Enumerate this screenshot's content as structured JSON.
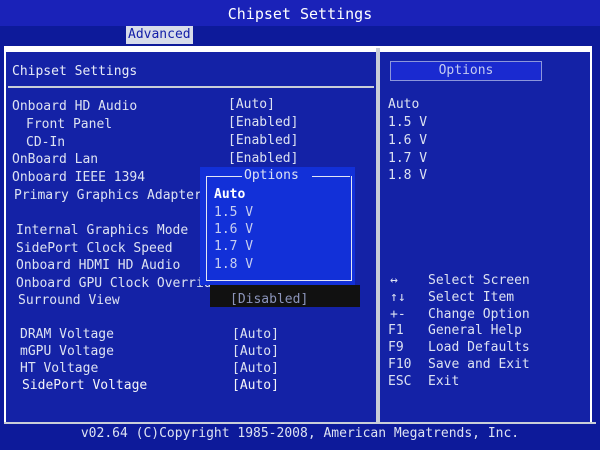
{
  "window": {
    "title": "Chipset Settings",
    "active_tab": "Advanced",
    "footer": "v02.64 (C)Copyright 1985-2008, American Megatrends, Inc."
  },
  "section": {
    "title": "Chipset Settings"
  },
  "settings": [
    {
      "label": "Onboard HD Audio",
      "value": "[Auto]"
    },
    {
      "label": "Front Panel",
      "value": "[Enabled]"
    },
    {
      "label": "CD-In",
      "value": "[Enabled]"
    },
    {
      "label": "OnBoard Lan",
      "value": "[Enabled]"
    },
    {
      "label": "Onboard IEEE 1394",
      "value": ""
    },
    {
      "label": "Primary Graphics Adapter",
      "value": ""
    },
    {
      "label": "Internal Graphics Mode",
      "value": ""
    },
    {
      "label": "SidePort Clock Speed",
      "value": ""
    },
    {
      "label": "Onboard HDMI HD Audio",
      "value": ""
    },
    {
      "label": "Onboard GPU Clock Override",
      "value": ""
    },
    {
      "label": "Surround View",
      "value": "[Disabled]"
    },
    {
      "label": "DRAM Voltage",
      "value": "[Auto]"
    },
    {
      "label": "mGPU Voltage",
      "value": "[Auto]"
    },
    {
      "label": "HT Voltage",
      "value": "[Auto]"
    },
    {
      "label": "SidePort Voltage",
      "value": "[Auto]"
    }
  ],
  "options_panel": {
    "title": "Options",
    "items": [
      "Auto",
      "1.5 V",
      "1.6 V",
      "1.7 V",
      "1.8 V"
    ]
  },
  "popup": {
    "title": "Options",
    "items": [
      "Auto",
      "1.5 V",
      "1.6 V",
      "1.7 V",
      "1.8 V"
    ],
    "selected": "Auto"
  },
  "help": [
    {
      "key": "↔",
      "text": "Select Screen"
    },
    {
      "key": "↑↓",
      "text": "Select Item"
    },
    {
      "key": "+-",
      "text": "Change Option"
    },
    {
      "key": "F1",
      "text": "General Help"
    },
    {
      "key": "F9",
      "text": "Load Defaults"
    },
    {
      "key": "F10",
      "text": "Save and Exit"
    },
    {
      "key": "ESC",
      "text": "Exit"
    }
  ]
}
